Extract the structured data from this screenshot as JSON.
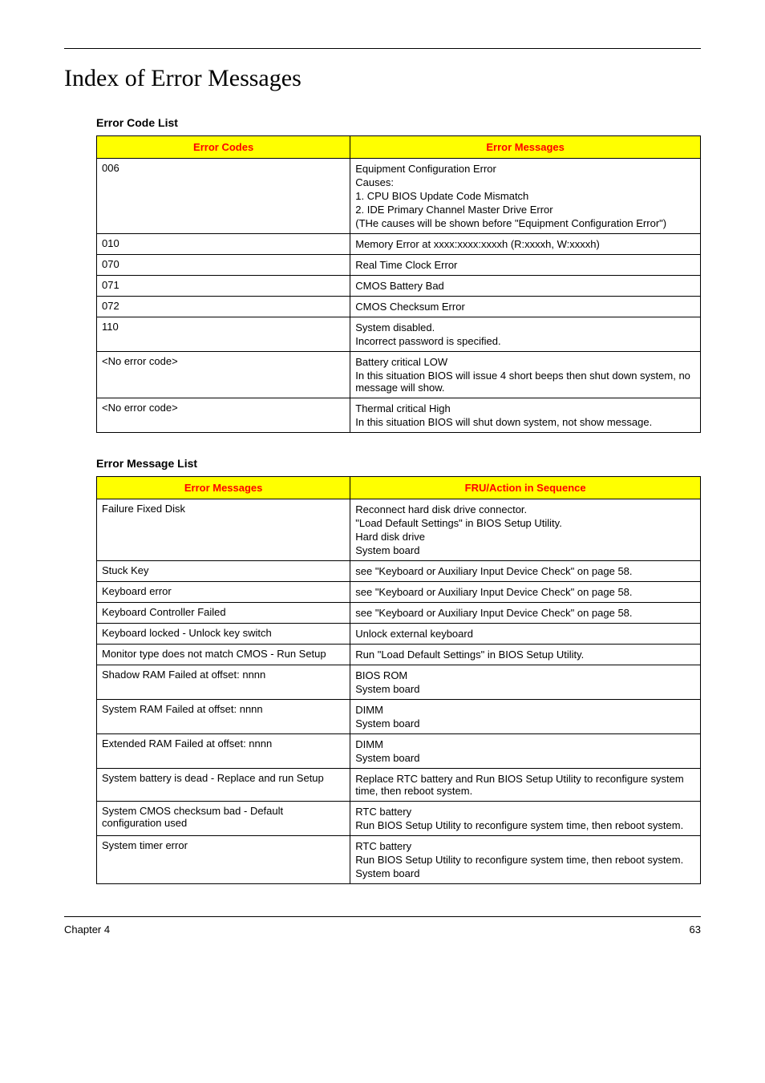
{
  "page_title": "Index of Error Messages",
  "table1": {
    "title": "Error Code List",
    "headers": [
      "Error Codes",
      "Error Messages"
    ],
    "rows": [
      {
        "code": "006",
        "lines": [
          "Equipment Configuration Error",
          "Causes:",
          "1. CPU BIOS Update Code Mismatch",
          "2. IDE Primary Channel Master Drive Error",
          "(THe causes will be shown before \"Equipment Configuration Error\")"
        ]
      },
      {
        "code": "010",
        "lines": [
          "Memory Error at xxxx:xxxx:xxxxh (R:xxxxh, W:xxxxh)"
        ]
      },
      {
        "code": "070",
        "lines": [
          "Real Time Clock Error"
        ]
      },
      {
        "code": "071",
        "lines": [
          "CMOS Battery Bad"
        ]
      },
      {
        "code": "072",
        "lines": [
          "CMOS Checksum Error"
        ]
      },
      {
        "code": "110",
        "lines": [
          "System disabled.",
          "Incorrect password is specified."
        ]
      },
      {
        "code": "<No error code>",
        "lines": [
          "Battery critical LOW",
          "In this situation BIOS will issue 4 short beeps then shut down system, no message will show."
        ]
      },
      {
        "code": "<No error code>",
        "lines": [
          "Thermal critical High",
          "In this situation BIOS will shut down system, not show message."
        ]
      }
    ]
  },
  "table2": {
    "title": "Error Message List",
    "headers": [
      "Error Messages",
      "FRU/Action in Sequence"
    ],
    "rows": [
      {
        "msg": "Failure Fixed Disk",
        "lines": [
          "Reconnect hard disk drive connector.",
          "\"Load Default Settings\" in BIOS Setup Utility.",
          "Hard disk drive",
          "System board"
        ]
      },
      {
        "msg": "Stuck Key",
        "lines": [
          "see \"Keyboard or Auxiliary Input Device Check\" on page 58."
        ]
      },
      {
        "msg": "Keyboard error",
        "lines": [
          "see \"Keyboard or Auxiliary Input Device Check\" on page 58."
        ]
      },
      {
        "msg": "Keyboard Controller Failed",
        "lines": [
          "see \"Keyboard or Auxiliary Input Device Check\" on page 58."
        ]
      },
      {
        "msg": "Keyboard locked - Unlock key switch",
        "lines": [
          "Unlock external keyboard"
        ]
      },
      {
        "msg": "Monitor type does not match CMOS - Run Setup",
        "lines": [
          "Run \"Load Default Settings\" in BIOS Setup Utility."
        ]
      },
      {
        "msg": "Shadow RAM Failed at offset: nnnn",
        "lines": [
          "BIOS ROM",
          "System board"
        ]
      },
      {
        "msg": "System RAM Failed at offset: nnnn",
        "lines": [
          "DIMM",
          "System board"
        ]
      },
      {
        "msg": "Extended RAM Failed at offset: nnnn",
        "lines": [
          "DIMM",
          "System board"
        ]
      },
      {
        "msg": "System battery is dead - Replace and run Setup",
        "lines": [
          "Replace RTC battery and Run BIOS Setup Utility to reconfigure system time, then reboot system."
        ]
      },
      {
        "msg": "System CMOS checksum bad - Default configuration used",
        "lines": [
          "RTC battery",
          "Run BIOS Setup Utility to reconfigure system time, then reboot system."
        ]
      },
      {
        "msg": "System timer error",
        "lines": [
          "RTC battery",
          "Run BIOS Setup Utility to reconfigure system time, then reboot system.",
          "System board"
        ]
      }
    ]
  },
  "footer": {
    "left": "Chapter 4",
    "right": "63"
  }
}
